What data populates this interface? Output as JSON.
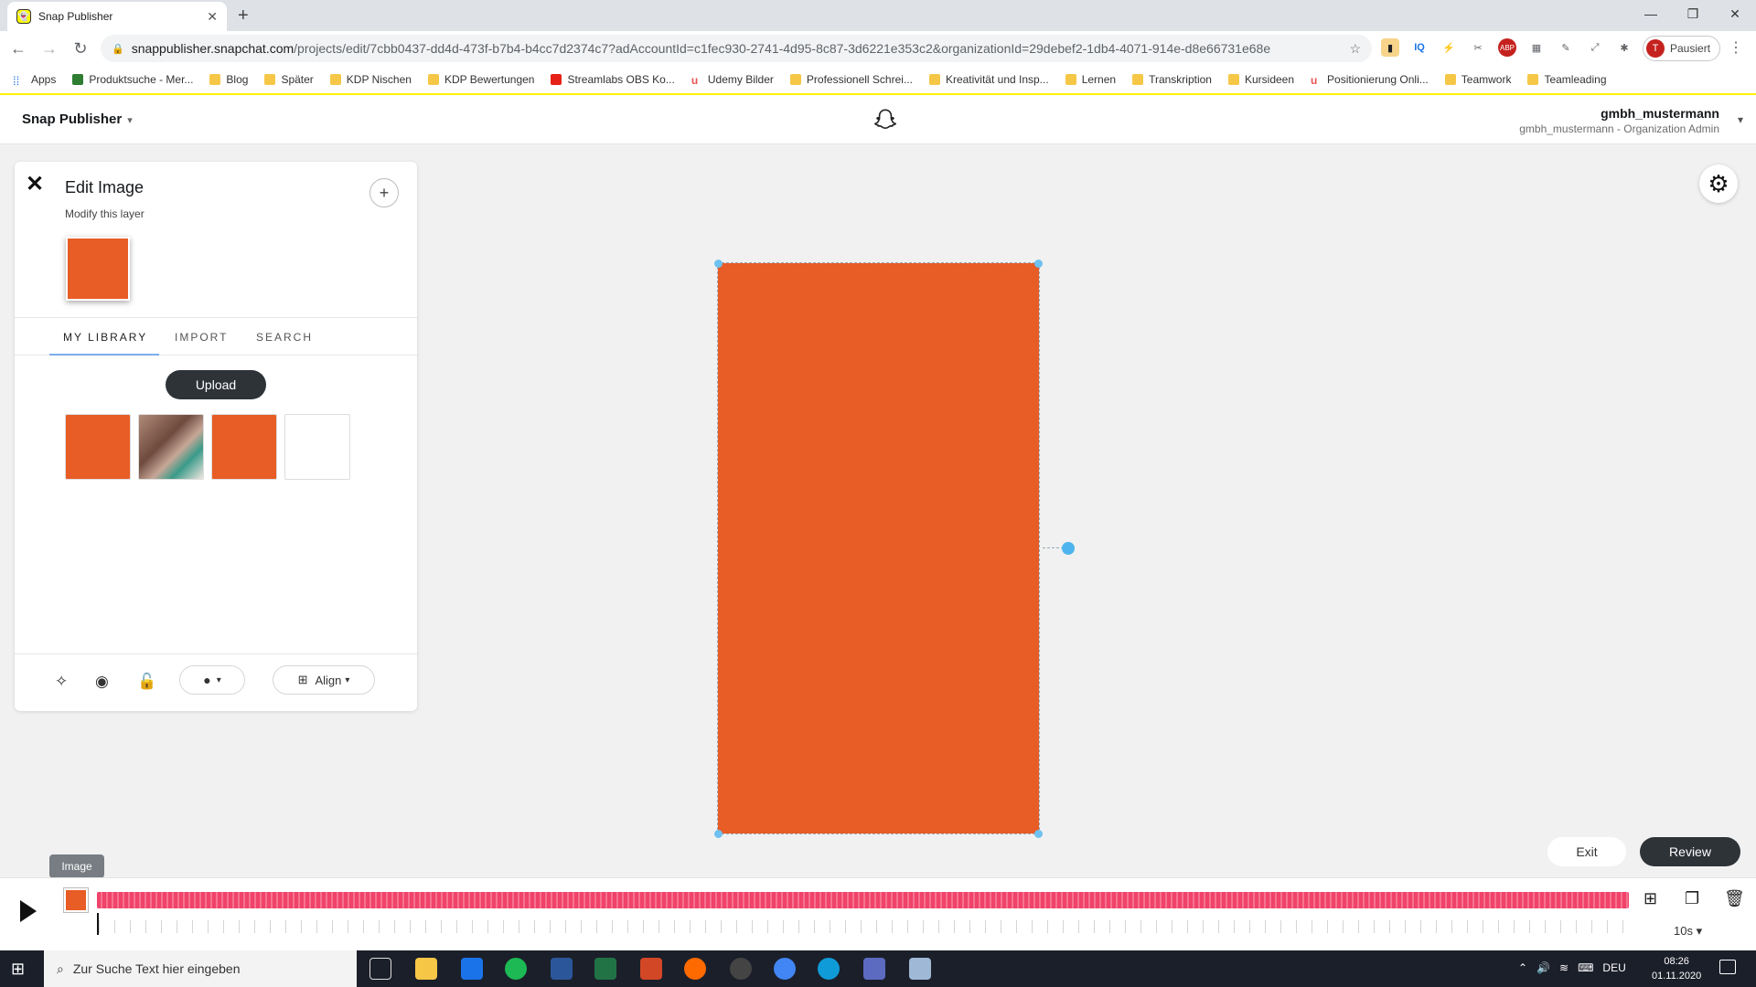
{
  "browser": {
    "tab_title": "Snap Publisher",
    "url_host": "snappublisher.snapchat.com",
    "url_path": "/projects/edit/7cbb0437-dd4d-473f-b7b4-b4cc7d2374c7?adAccountId=c1fec930-2741-4d95-8c87-3d6221e353c2&organizationId=29debef2-1db4-4071-914e-d8e66731e68e",
    "profile_initial": "T",
    "profile_label": "Pausiert",
    "bookmarks": [
      "Apps",
      "Produktsuche - Mer...",
      "Blog",
      "Später",
      "KDP Nischen",
      "KDP Bewertungen",
      "Streamlabs OBS Ko...",
      "Udemy Bilder",
      "Professionell Schrei...",
      "Kreativität und Insp...",
      "Lernen",
      "Transkription",
      "Kursideen",
      "Positionierung Onli...",
      "Teamwork",
      "Teamleading"
    ]
  },
  "header": {
    "brand": "Snap Publisher",
    "username": "gmbh_mustermann",
    "role": "gmbh_mustermann - Organization Admin"
  },
  "panel": {
    "title": "Edit Image",
    "subtitle": "Modify this layer",
    "tabs": [
      "MY LIBRARY",
      "IMPORT",
      "SEARCH"
    ],
    "active_tab": "MY LIBRARY",
    "upload_label": "Upload",
    "align_label": "Align",
    "library_thumbs": [
      "orange",
      "photo",
      "orange",
      "blank"
    ]
  },
  "canvas": {
    "color": "#e85c25"
  },
  "actions": {
    "exit_label": "Exit",
    "review_label": "Review"
  },
  "timeline": {
    "tooltip": "Image",
    "duration": "10s"
  },
  "taskbar": {
    "search_placeholder": "Zur Suche Text hier eingeben",
    "language": "DEU",
    "time": "08:26",
    "date": "01.11.2020"
  },
  "colors": {
    "accent": "#e85c25",
    "track": "#f0436a",
    "dark_button": "#2e3338",
    "handle": "#6ec1f0"
  }
}
